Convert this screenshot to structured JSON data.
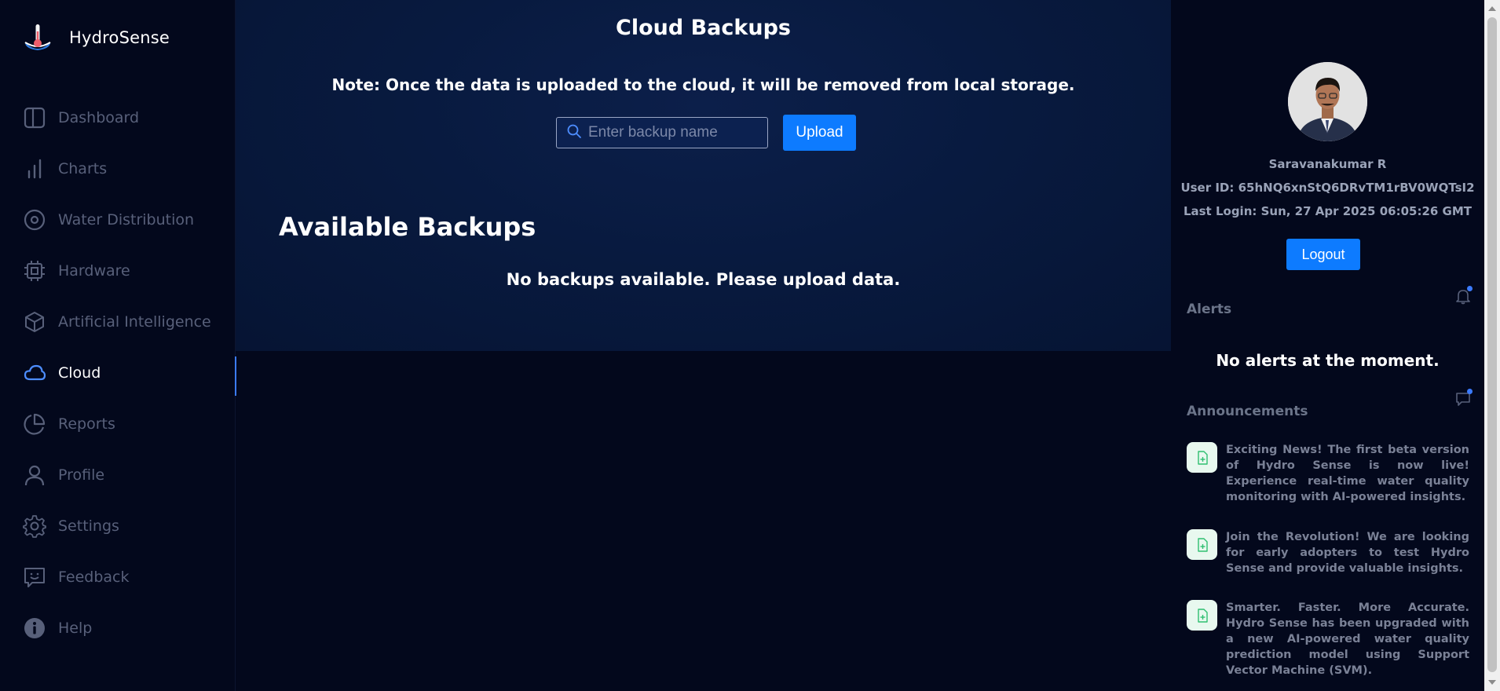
{
  "app": {
    "name": "HydroSense"
  },
  "sidebar": {
    "items": [
      {
        "label": "Dashboard",
        "icon": "layout-icon"
      },
      {
        "label": "Charts",
        "icon": "bar-chart-icon"
      },
      {
        "label": "Water Distribution",
        "icon": "target-icon"
      },
      {
        "label": "Hardware",
        "icon": "cpu-icon"
      },
      {
        "label": "Artificial Intelligence",
        "icon": "cube-icon"
      },
      {
        "label": "Cloud",
        "icon": "cloud-icon",
        "active": true
      },
      {
        "label": "Reports",
        "icon": "pie-chart-icon"
      },
      {
        "label": "Profile",
        "icon": "user-icon"
      },
      {
        "label": "Settings",
        "icon": "gear-icon"
      },
      {
        "label": "Feedback",
        "icon": "feedback-icon"
      },
      {
        "label": "Help",
        "icon": "info-icon"
      }
    ]
  },
  "main": {
    "title": "Cloud Backups",
    "note": "Note: Once the data is uploaded to the cloud, it will be removed from local storage.",
    "search_placeholder": "Enter backup name",
    "upload_label": "Upload",
    "section_title": "Available Backups",
    "empty_message": "No backups available. Please upload data."
  },
  "user": {
    "name": "Saravanakumar R",
    "user_id": "User ID: 65hNQ6xnStQ6DRvTM1rBV0WQTsI2",
    "last_login": "Last Login: Sun, 27 Apr 2025 06:05:26 GMT",
    "logout_label": "Logout"
  },
  "alerts": {
    "heading": "Alerts",
    "empty_message": "No alerts at the moment."
  },
  "announcements": {
    "heading": "Announcements",
    "items": [
      "Exciting News! The first beta version of Hydro Sense is now live! Experience real-time water quality monitoring with AI-powered insights.",
      "Join the Revolution! We are looking for early adopters to test Hydro Sense and provide valuable insights.",
      "Smarter. Faster. More Accurate. Hydro Sense has been upgraded with a new AI-powered water quality prediction model using Support Vector Machine (SVM)."
    ]
  },
  "colors": {
    "accent": "#0d7bff",
    "background": "#03081c",
    "panel": "#081a3f",
    "muted_text": "#58607a"
  }
}
